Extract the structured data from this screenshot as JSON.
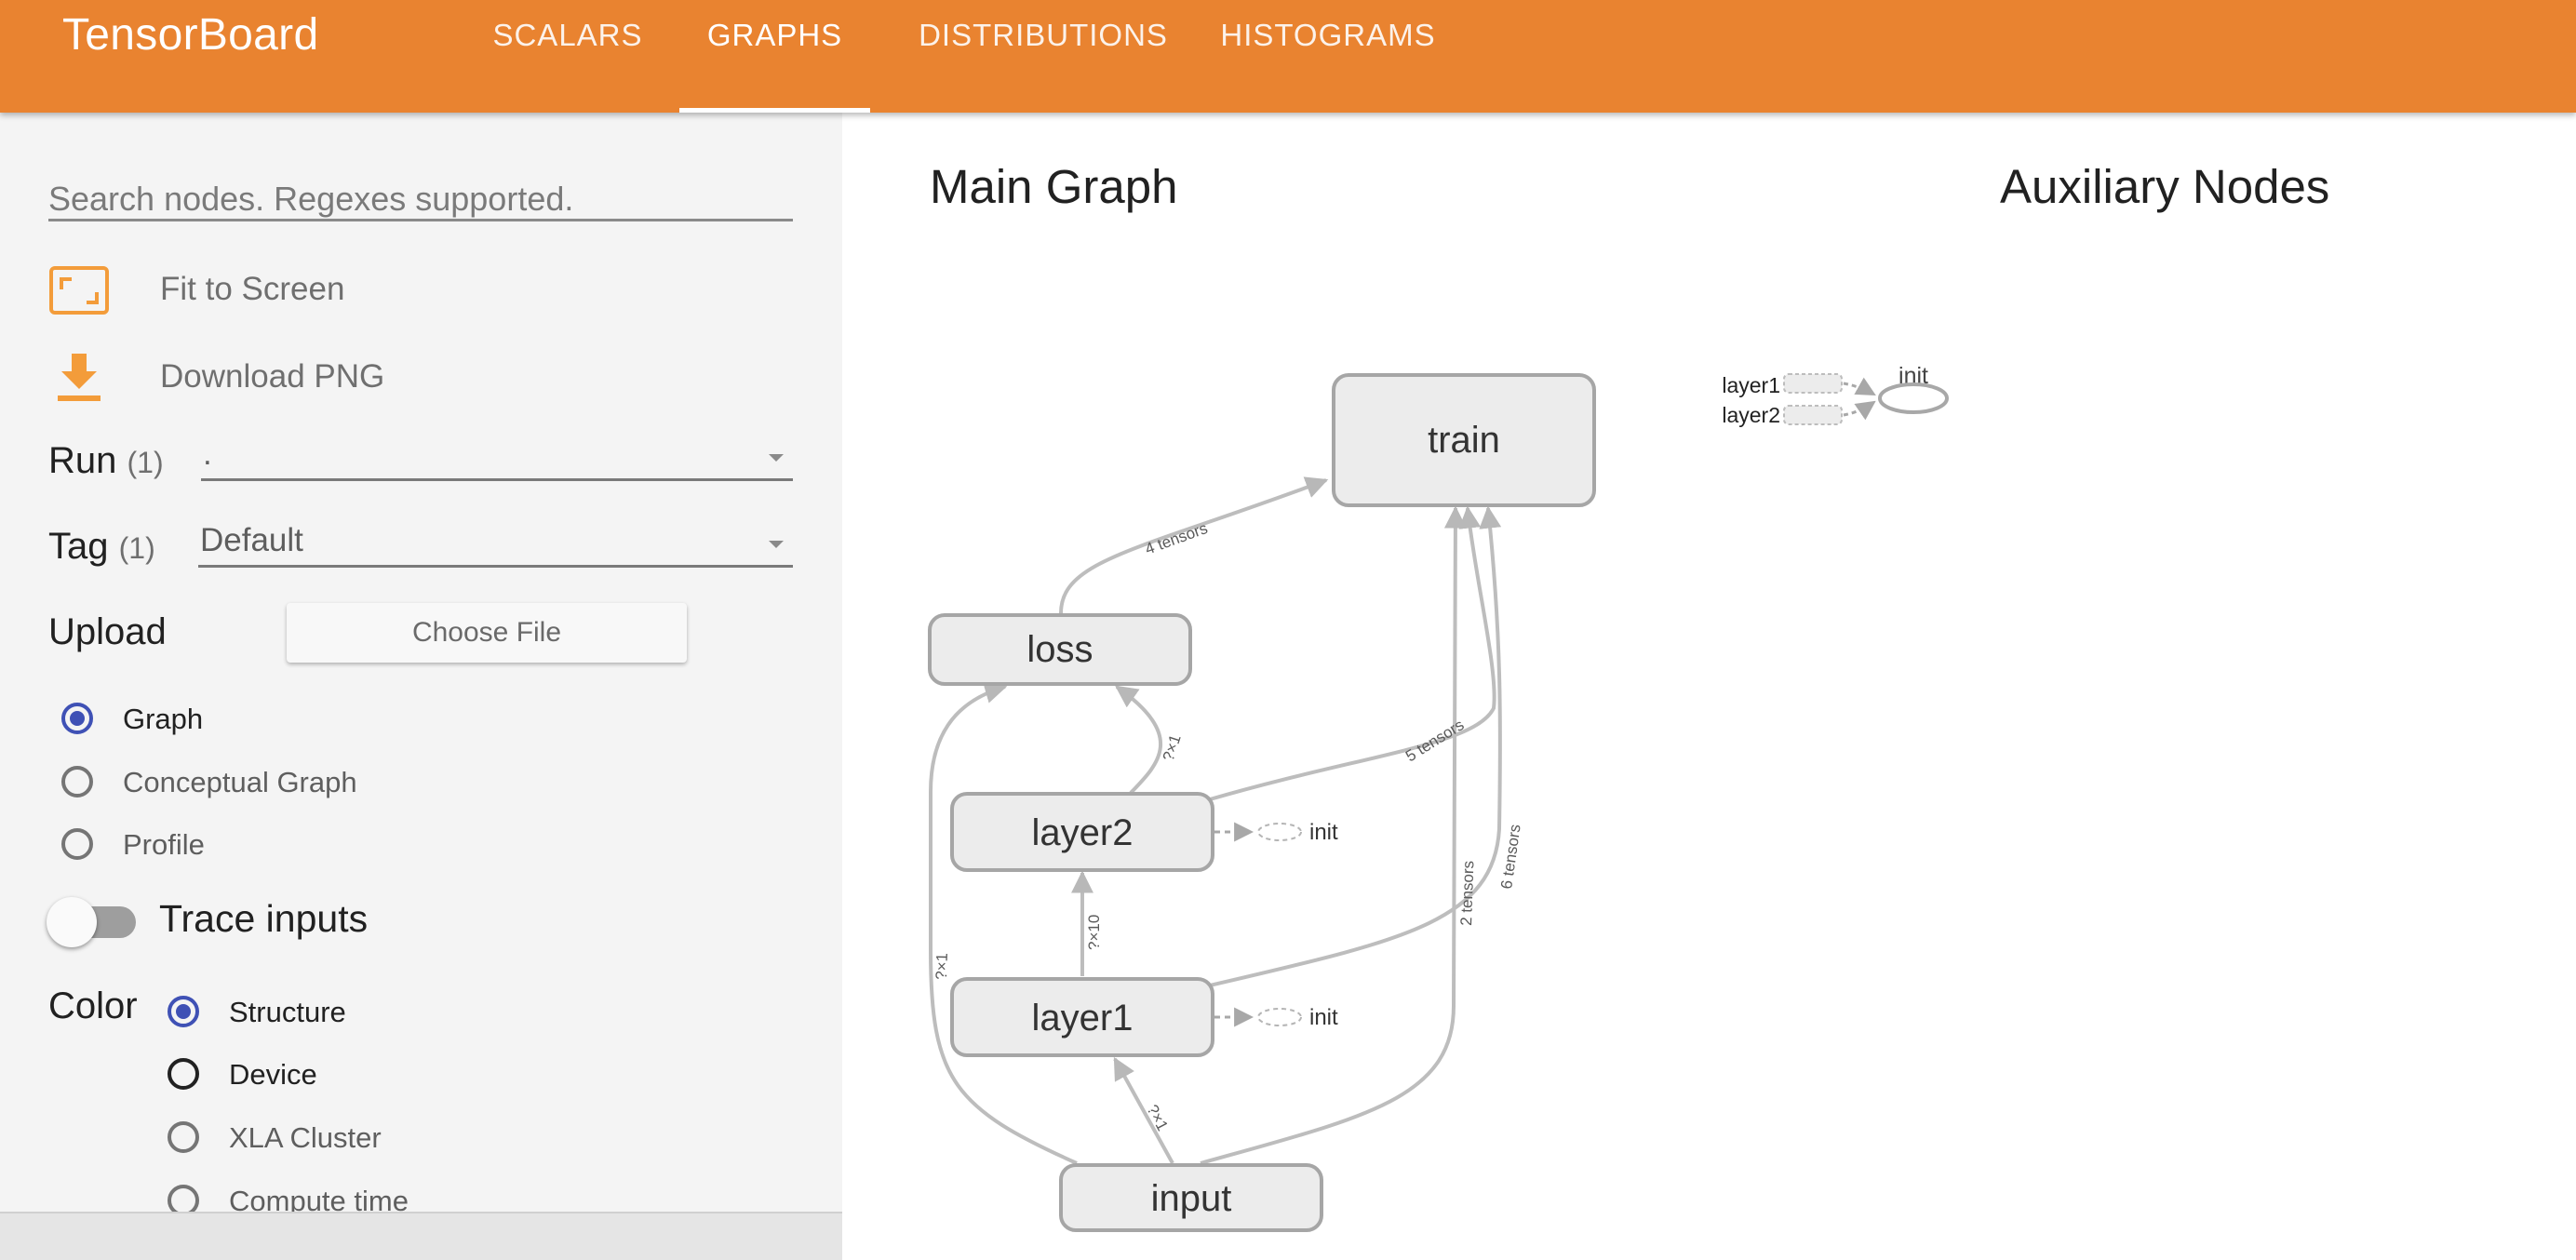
{
  "app": {
    "title": "TensorBoard",
    "tabs": [
      {
        "label": "SCALARS",
        "active": false
      },
      {
        "label": "GRAPHS",
        "active": true
      },
      {
        "label": "DISTRIBUTIONS",
        "active": false
      },
      {
        "label": "HISTOGRAMS",
        "active": false
      }
    ],
    "accent_color": "#e98330"
  },
  "sidebar": {
    "search_placeholder": "Search nodes. Regexes supported.",
    "fit_to_screen": "Fit to Screen",
    "download_png": "Download PNG",
    "run": {
      "label": "Run",
      "count": "(1)",
      "value": "."
    },
    "tag": {
      "label": "Tag",
      "count": "(1)",
      "value": "Default"
    },
    "upload": {
      "label": "Upload",
      "button": "Choose File"
    },
    "graph_type": [
      {
        "label": "Graph",
        "checked": true
      },
      {
        "label": "Conceptual Graph",
        "checked": false
      },
      {
        "label": "Profile",
        "checked": false
      }
    ],
    "trace_inputs": {
      "label": "Trace inputs",
      "on": false
    },
    "color": {
      "label": "Color",
      "options": [
        {
          "label": "Structure",
          "checked": true
        },
        {
          "label": "Device",
          "checked": false
        },
        {
          "label": "XLA Cluster",
          "checked": false
        },
        {
          "label": "Compute time",
          "checked": false
        }
      ]
    }
  },
  "graph": {
    "main_title": "Main Graph",
    "aux_title": "Auxiliary Nodes",
    "nodes": {
      "train": "train",
      "loss": "loss",
      "layer2": "layer2",
      "layer1": "layer1",
      "input": "input",
      "init": "init"
    },
    "edge_labels": {
      "loss_train": "4 tensors",
      "layer2_loss": "?×1",
      "layer2_train": "5 tensors",
      "layer1_layer2": "?×10",
      "layer1_train": "6 tensors",
      "input_train": "2 tensors",
      "input_loss": "?×1",
      "input_layer1": "?×1"
    },
    "aux_inputs": [
      "layer1",
      "layer2"
    ],
    "aux_node": "init"
  }
}
